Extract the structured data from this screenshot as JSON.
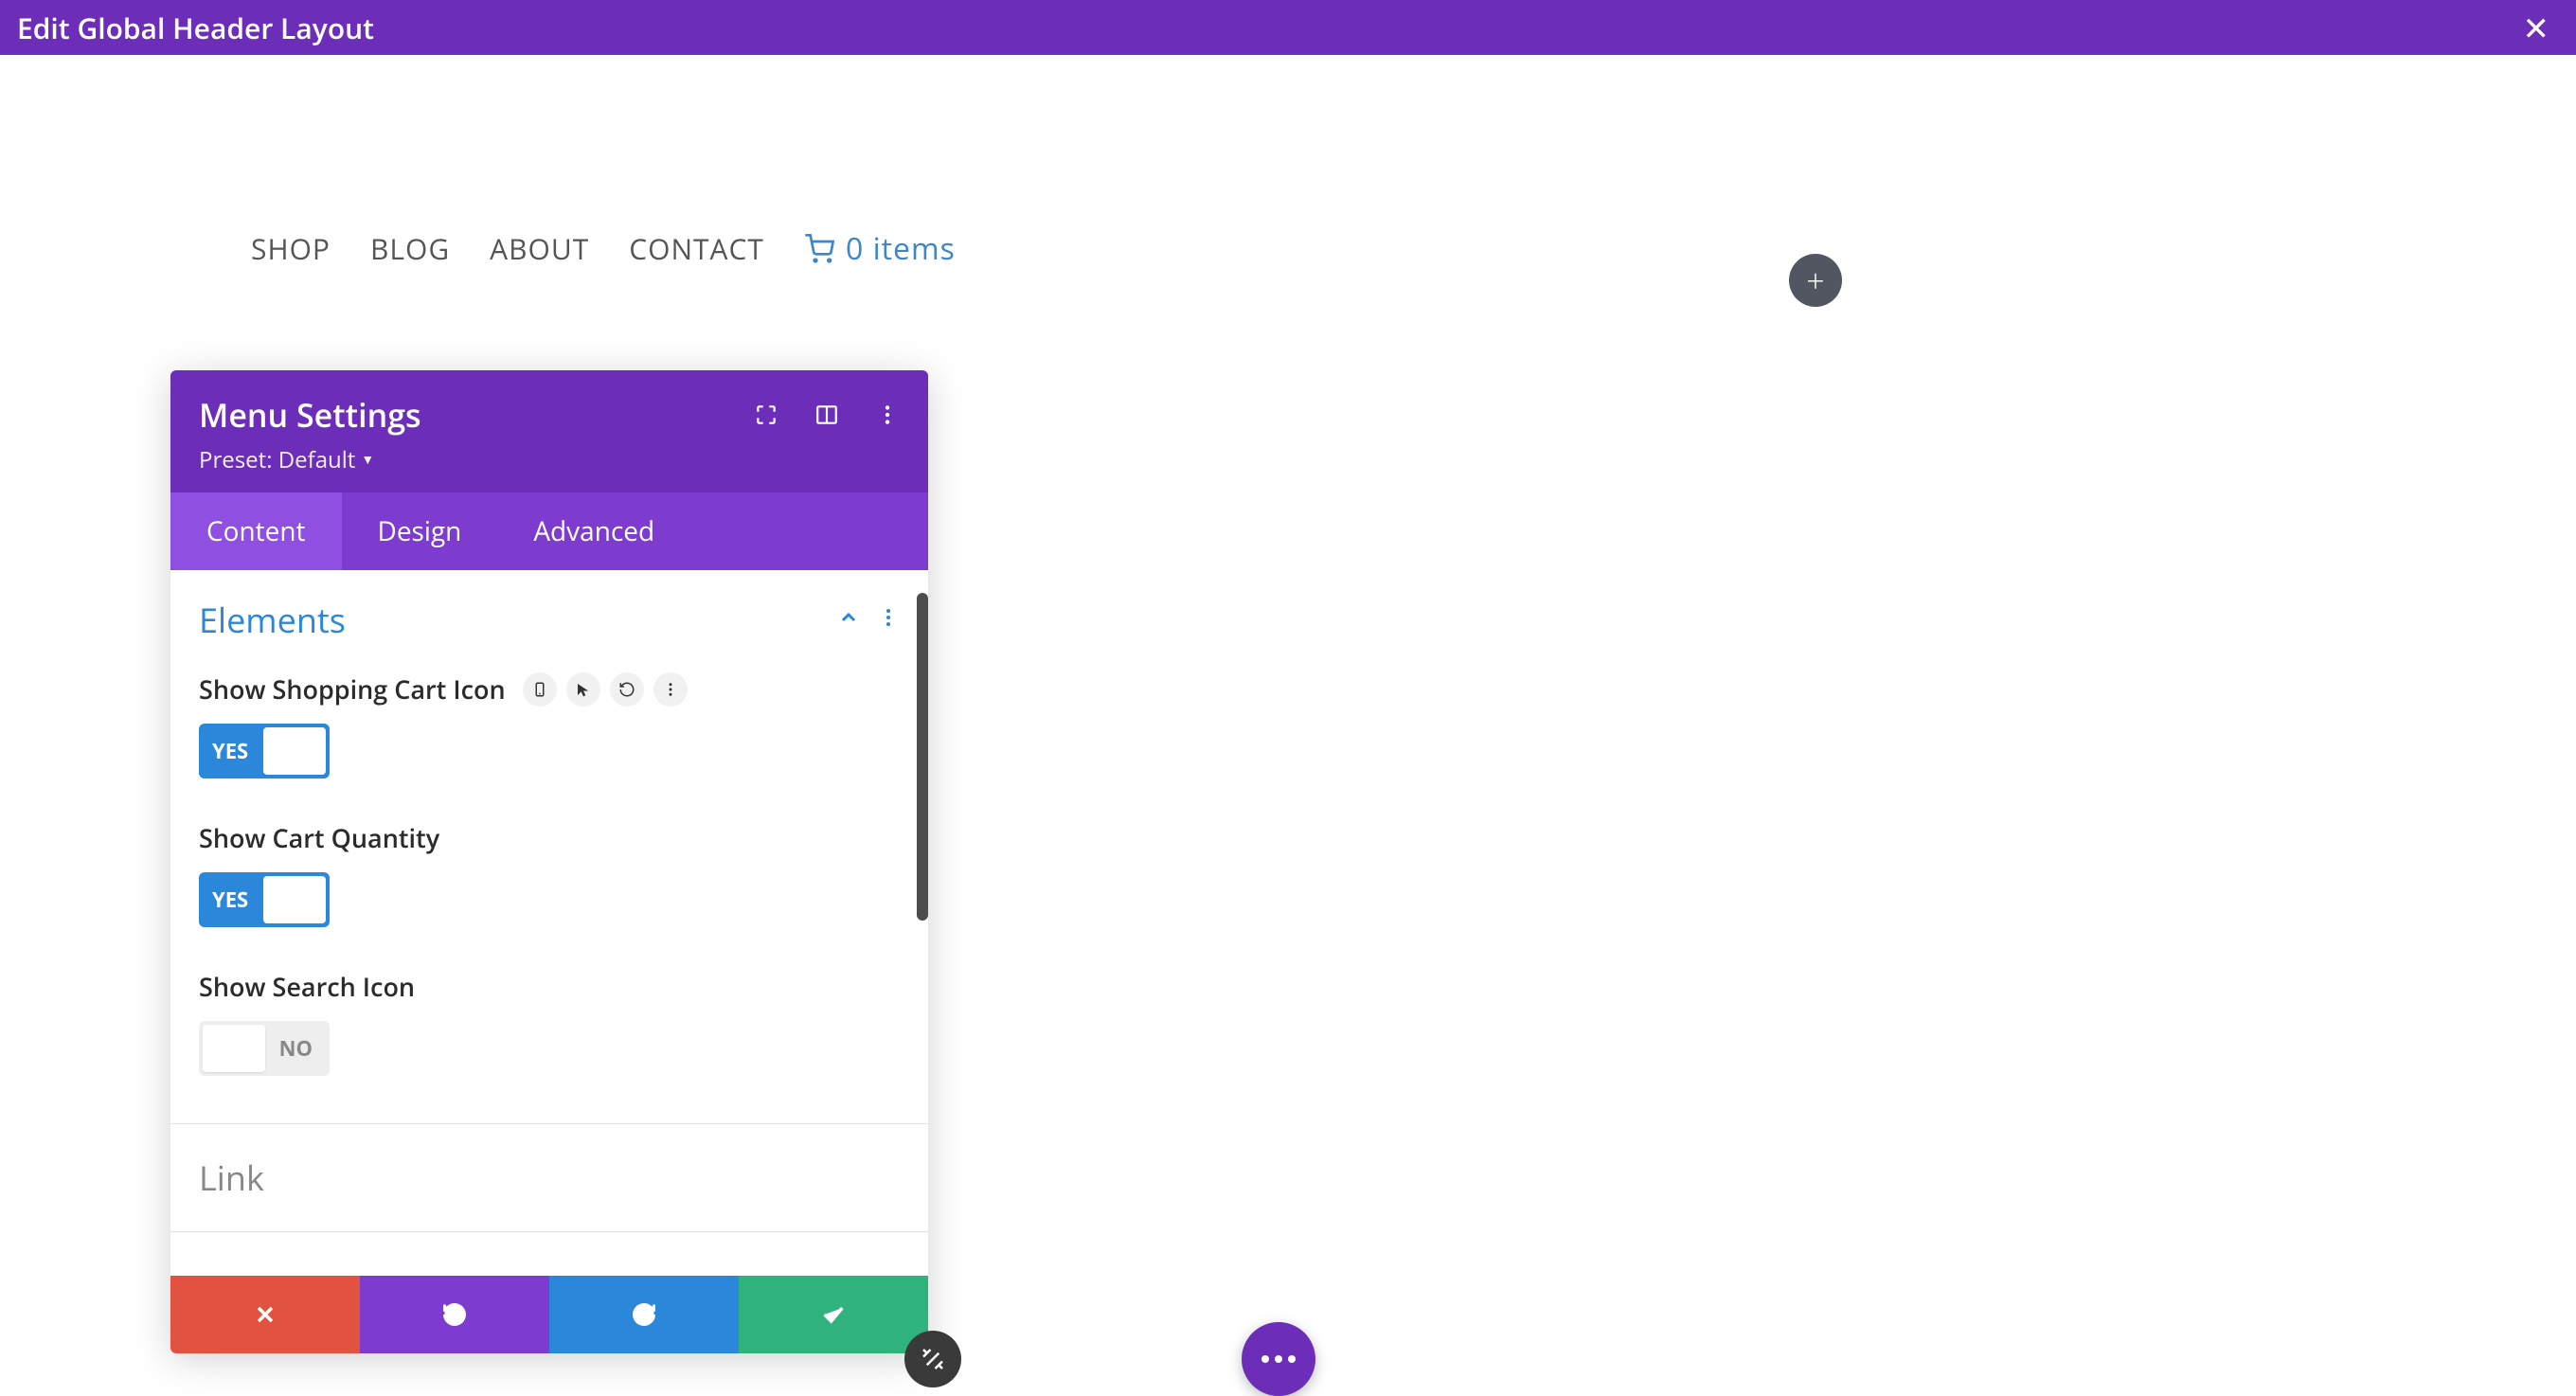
{
  "topbar": {
    "title": "Edit Global Header Layout"
  },
  "nav": {
    "items": [
      "SHOP",
      "BLOG",
      "ABOUT",
      "CONTACT"
    ],
    "cart_text": "0 items"
  },
  "panel": {
    "title": "Menu Settings",
    "preset": "Preset: Default",
    "tabs": {
      "content": "Content",
      "design": "Design",
      "advanced": "Advanced"
    },
    "sections": {
      "elements": {
        "title": "Elements",
        "options": {
          "show_cart_icon": {
            "label": "Show Shopping Cart Icon",
            "value": "YES",
            "on": true
          },
          "show_cart_qty": {
            "label": "Show Cart Quantity",
            "value": "YES",
            "on": true
          },
          "show_search": {
            "label": "Show Search Icon",
            "value": "NO",
            "on": false
          }
        }
      },
      "link": {
        "title": "Link"
      }
    }
  },
  "colors": {
    "purple": "#6c2eb9",
    "purple_light": "#7e3bd0",
    "tab_active": "#8f4fe0",
    "blue": "#2b87da",
    "green": "#2fb27d",
    "red": "#e15241"
  }
}
